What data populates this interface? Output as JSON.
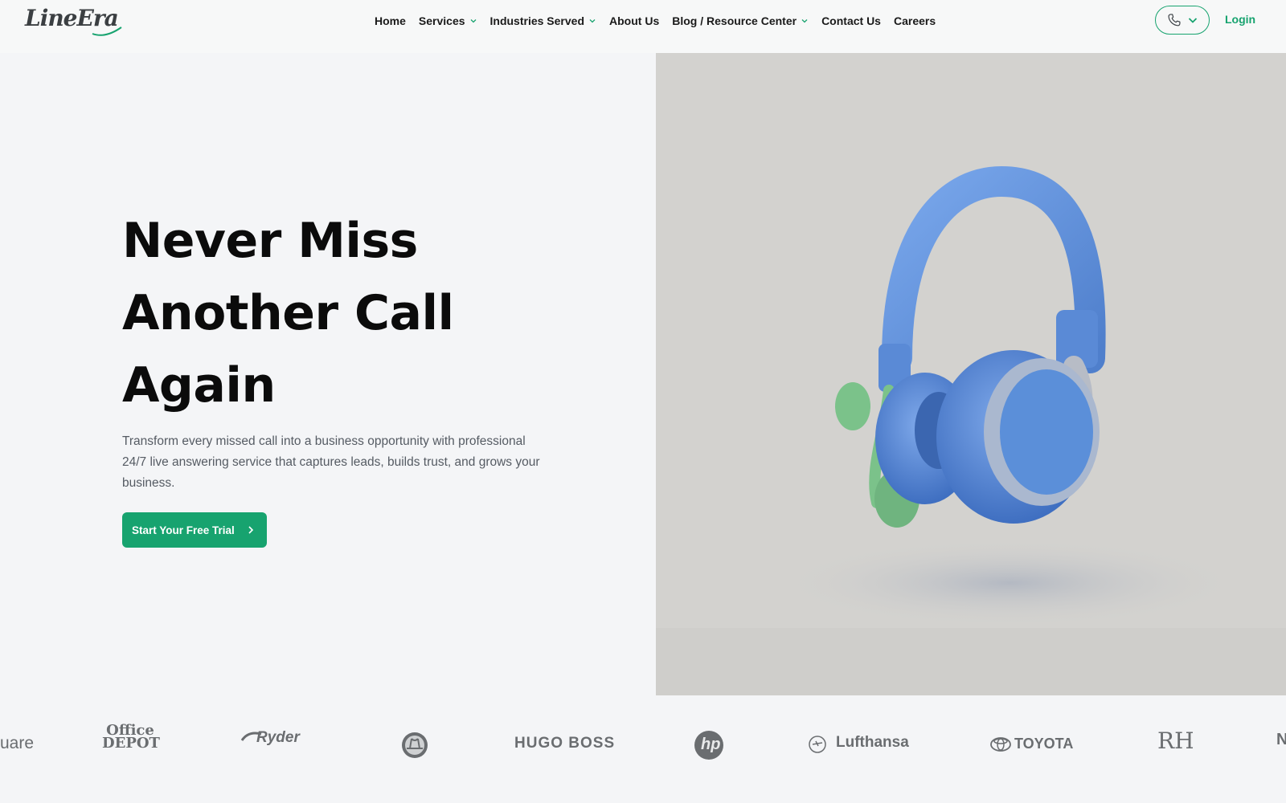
{
  "brand": {
    "logo_text": "LineEra"
  },
  "nav": {
    "items": [
      {
        "label": "Home",
        "has_dropdown": false
      },
      {
        "label": "Services",
        "has_dropdown": true
      },
      {
        "label": "Industries Served",
        "has_dropdown": true
      },
      {
        "label": "About Us",
        "has_dropdown": false
      },
      {
        "label": "Blog / Resource Center",
        "has_dropdown": true
      },
      {
        "label": "Contact Us",
        "has_dropdown": false
      },
      {
        "label": "Careers",
        "has_dropdown": false
      }
    ],
    "login_label": "Login",
    "phone_icon": "phone-icon"
  },
  "hero": {
    "title_lines": [
      "Never Miss",
      "Another Call",
      "Again"
    ],
    "subtitle": "Transform every missed call into a business opportunity with professional 24/7 live answering service that captures leads, builds trust, and grows your business.",
    "cta_label": "Start Your Free Trial"
  },
  "logos": {
    "items": [
      "uare",
      "Office DEPOT",
      "Ryder",
      "Golden State Warriors",
      "HUGO BOSS",
      "hp",
      "Lufthansa",
      "TOYOTA",
      "RH",
      "N"
    ]
  },
  "colors": {
    "accent": "#17a36f",
    "background": "#f4f5f7",
    "image_panel": "#d3d2cf",
    "headset_blue": "#5b8fd9",
    "mic_green": "#7bc28a"
  }
}
